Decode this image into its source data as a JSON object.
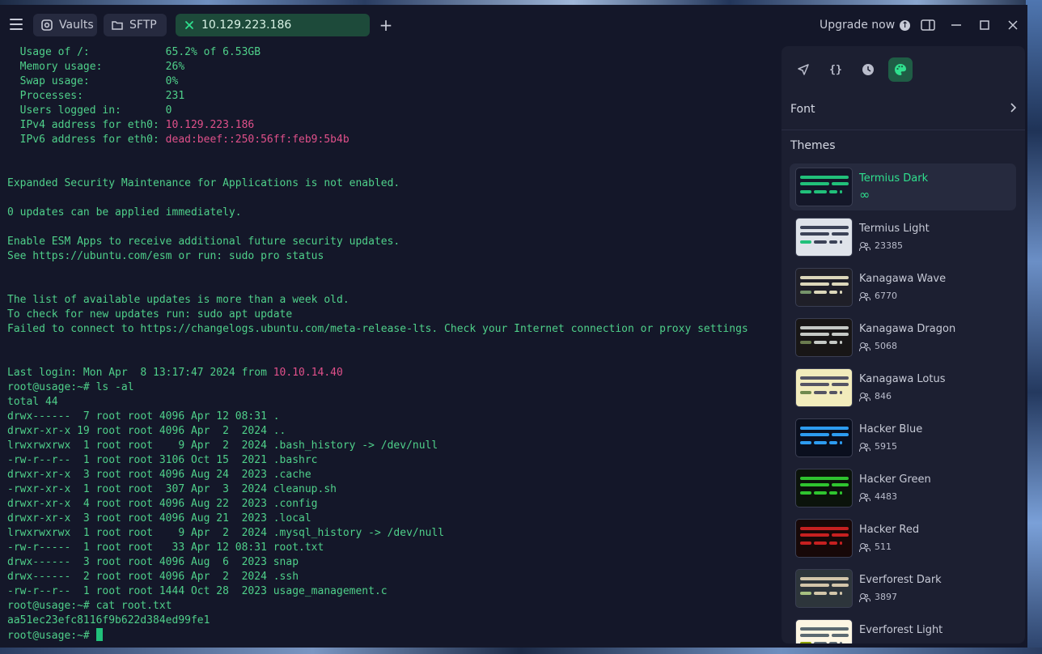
{
  "titlebar": {
    "tabs": [
      {
        "label": "Vaults",
        "icon": "vault-icon"
      },
      {
        "label": "SFTP",
        "icon": "folder-icon"
      },
      {
        "label": "10.129.223.186",
        "icon": "close-icon",
        "active": true
      }
    ],
    "new_tab": "+",
    "upgrade_label": "Upgrade now"
  },
  "terminal": {
    "lines": [
      [
        {
          "t": "  Usage of /:            65.2% of 6.53GB"
        }
      ],
      [
        {
          "t": "  Memory usage:          26%"
        }
      ],
      [
        {
          "t": "  Swap usage:            0%"
        }
      ],
      [
        {
          "t": "  Processes:             231"
        }
      ],
      [
        {
          "t": "  Users logged in:       0"
        }
      ],
      [
        {
          "t": "  IPv4 address for eth0: "
        },
        {
          "t": "10.129.223.186",
          "c": "pink"
        }
      ],
      [
        {
          "t": "  IPv6 address for eth0: "
        },
        {
          "t": "dead:beef::250:56ff:feb9:5b4b",
          "c": "pink"
        }
      ],
      [
        {
          "t": ""
        }
      ],
      [
        {
          "t": ""
        }
      ],
      [
        {
          "t": "Expanded Security Maintenance for Applications is not enabled."
        }
      ],
      [
        {
          "t": ""
        }
      ],
      [
        {
          "t": "0 updates can be applied immediately."
        }
      ],
      [
        {
          "t": ""
        }
      ],
      [
        {
          "t": "Enable ESM Apps to receive additional future security updates."
        }
      ],
      [
        {
          "t": "See https://ubuntu.com/esm or run: sudo pro status"
        }
      ],
      [
        {
          "t": ""
        }
      ],
      [
        {
          "t": ""
        }
      ],
      [
        {
          "t": "The list of available updates is more than a week old."
        }
      ],
      [
        {
          "t": "To check for new updates run: sudo apt update"
        }
      ],
      [
        {
          "t": "Failed to connect to https://changelogs.ubuntu.com/meta-release-lts. Check your Internet connection or proxy settings"
        }
      ],
      [
        {
          "t": ""
        }
      ],
      [
        {
          "t": ""
        }
      ],
      [
        {
          "t": "Last login: Mon Apr  8 13:17:47 2024 from "
        },
        {
          "t": "10.10.14.40",
          "c": "pink"
        }
      ],
      [
        {
          "t": "root@usage:~# ls -al"
        }
      ],
      [
        {
          "t": "total 44"
        }
      ],
      [
        {
          "t": "drwx------  7 root root 4096 Apr 12 08:31 ."
        }
      ],
      [
        {
          "t": "drwxr-xr-x 19 root root 4096 Apr  2  2024 .."
        }
      ],
      [
        {
          "t": "lrwxrwxrwx  1 root root    9 Apr  2  2024 .bash_history -> /dev/null"
        }
      ],
      [
        {
          "t": "-rw-r--r--  1 root root 3106 Oct 15  2021 .bashrc"
        }
      ],
      [
        {
          "t": "drwxr-xr-x  3 root root 4096 Aug 24  2023 .cache"
        }
      ],
      [
        {
          "t": "-rwxr-xr-x  1 root root  307 Apr  3  2024 cleanup.sh"
        }
      ],
      [
        {
          "t": "drwxr-xr-x  4 root root 4096 Aug 22  2023 .config"
        }
      ],
      [
        {
          "t": "drwxr-xr-x  3 root root 4096 Aug 21  2023 .local"
        }
      ],
      [
        {
          "t": "lrwxrwxrwx  1 root root    9 Apr  2  2024 .mysql_history -> /dev/null"
        }
      ],
      [
        {
          "t": "-rw-r-----  1 root root   33 Apr 12 08:31 root.txt"
        }
      ],
      [
        {
          "t": "drwx------  3 root root 4096 Aug  6  2023 snap"
        }
      ],
      [
        {
          "t": "drwx------  2 root root 4096 Apr  2  2024 .ssh"
        }
      ],
      [
        {
          "t": "-rw-r--r--  1 root root 1444 Oct 28  2023 usage_management.c"
        }
      ],
      [
        {
          "t": "root@usage:~# cat root.txt"
        }
      ],
      [
        {
          "t": "aa51ec23efc8116f9b622d384ed99fe1"
        }
      ],
      [
        {
          "t": "root@usage:~# "
        },
        {
          "cursor": true
        }
      ]
    ]
  },
  "sidebar": {
    "font_label": "Font",
    "themes_label": "Themes",
    "themes": [
      {
        "name": "Termius Dark",
        "count": "∞",
        "active": true,
        "bg": "#141729",
        "accent": "#21c07a",
        "fg": "#21c07a"
      },
      {
        "name": "Termius Light",
        "count": "23385",
        "bg": "#dfe3ea",
        "accent": "#21c07a",
        "fg": "#3b4257"
      },
      {
        "name": "Kanagawa Wave",
        "count": "6770",
        "bg": "#1f1f28",
        "accent": "#76946a",
        "fg": "#dcd7ba"
      },
      {
        "name": "Kanagawa Dragon",
        "count": "5068",
        "bg": "#181616",
        "accent": "#6a7c4f",
        "fg": "#c5c9c5"
      },
      {
        "name": "Kanagawa Lotus",
        "count": "846",
        "bg": "#f2ecbc",
        "accent": "#6f894e",
        "fg": "#545464"
      },
      {
        "name": "Hacker Blue",
        "count": "5915",
        "bg": "#0a0f1e",
        "accent": "#2d9cf0",
        "fg": "#2d9cf0"
      },
      {
        "name": "Hacker Green",
        "count": "4483",
        "bg": "#0b130b",
        "accent": "#2fc42f",
        "fg": "#2fc42f"
      },
      {
        "name": "Hacker Red",
        "count": "511",
        "bg": "#170808",
        "accent": "#c62020",
        "fg": "#c62020"
      },
      {
        "name": "Everforest Dark",
        "count": "3897",
        "bg": "#2d353b",
        "accent": "#a7c080",
        "fg": "#d3c6aa"
      },
      {
        "name": "Everforest Light",
        "count": "",
        "bg": "#fdf6e3",
        "accent": "#8da101",
        "fg": "#5c6a72"
      }
    ]
  }
}
